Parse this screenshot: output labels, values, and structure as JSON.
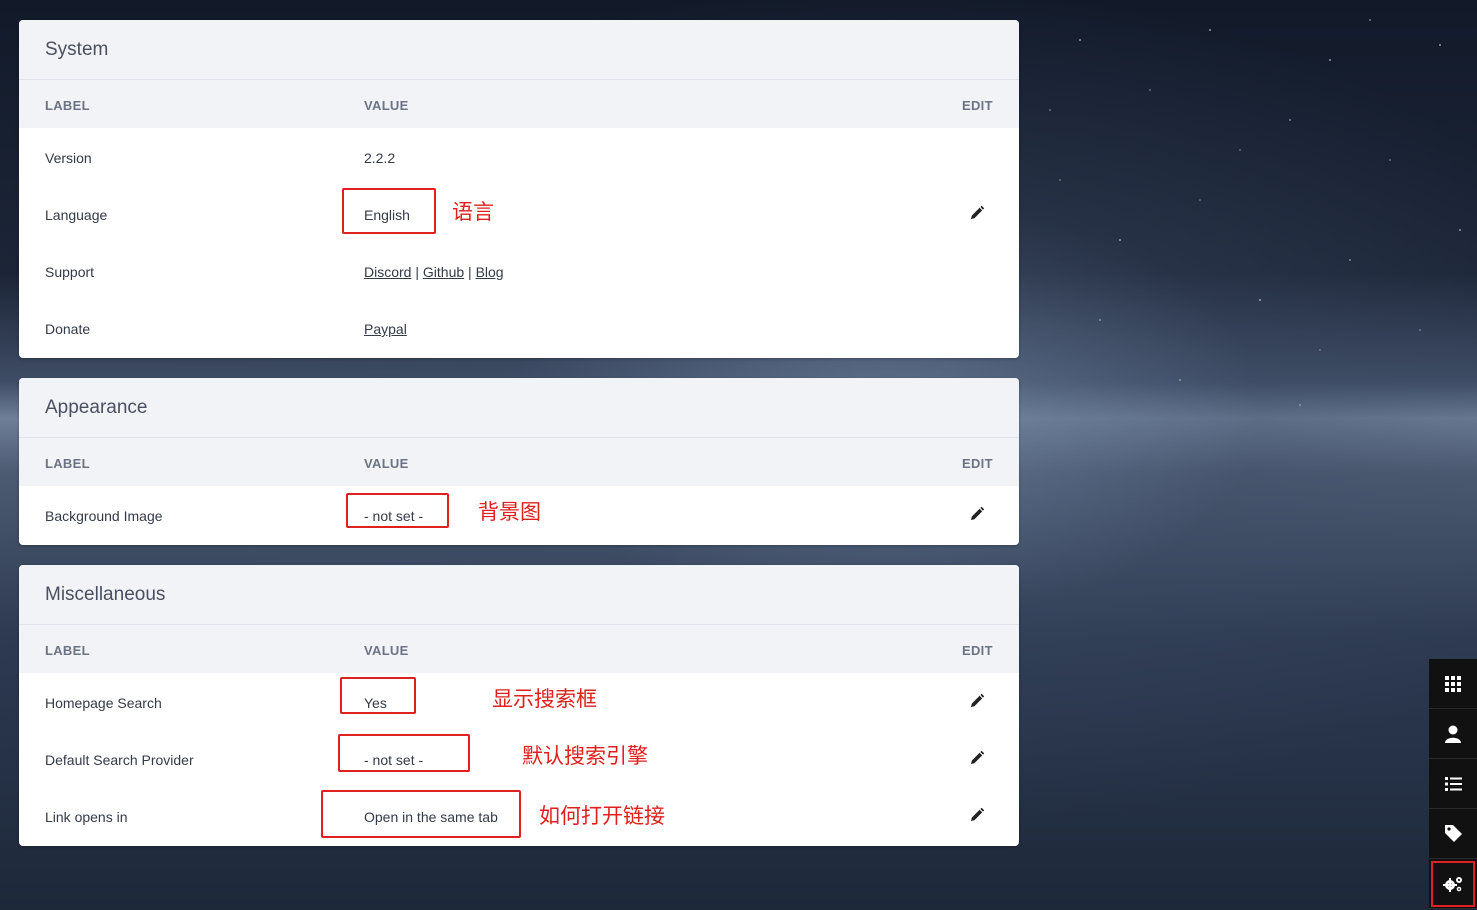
{
  "columns": {
    "label": "LABEL",
    "value": "VALUE",
    "edit": "EDIT"
  },
  "system": {
    "title": "System",
    "version": {
      "label": "Version",
      "value": "2.2.2"
    },
    "language": {
      "label": "Language",
      "value": "English"
    },
    "support": {
      "label": "Support",
      "links": [
        "Discord",
        "Github",
        "Blog"
      ],
      "separator": "|"
    },
    "donate": {
      "label": "Donate",
      "link": "Paypal"
    }
  },
  "appearance": {
    "title": "Appearance",
    "background": {
      "label": "Background Image",
      "value": "- not set -"
    }
  },
  "misc": {
    "title": "Miscellaneous",
    "homepage_search": {
      "label": "Homepage Search",
      "value": "Yes"
    },
    "search_provider": {
      "label": "Default Search Provider",
      "value": "- not set -"
    },
    "link_opens": {
      "label": "Link opens in",
      "value": "Open in the same tab"
    }
  },
  "annotations": {
    "language": "语言",
    "background": "背景图",
    "homepage_search": "显示搜索框",
    "search_provider": "默认搜索引擎",
    "link_opens": "如何打开链接"
  },
  "sidebar": [
    "grid-icon",
    "user-icon",
    "list-icon",
    "tag-icon",
    "settings-cogs-icon"
  ],
  "colors": {
    "annotation": "#e0201e",
    "sidebar": "#111111",
    "header_bg": "#f2f3f7"
  }
}
